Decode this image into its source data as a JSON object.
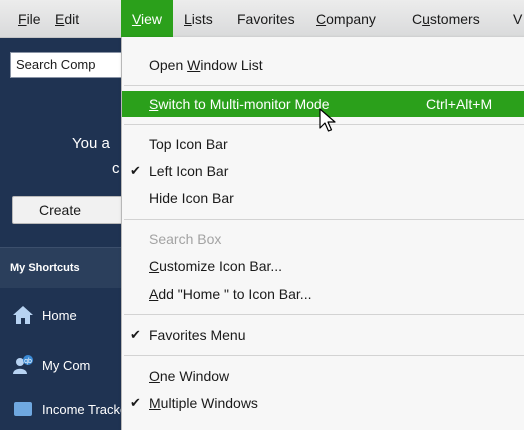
{
  "menubar": {
    "items": [
      {
        "label": "File",
        "mnemonic": "F",
        "rest": "ile"
      },
      {
        "label": "Edit",
        "mnemonic": "E",
        "rest": "dit"
      },
      {
        "label": "View",
        "mnemonic": "V",
        "rest": "iew"
      },
      {
        "label": "Lists",
        "mnemonic": "L",
        "rest": "ists"
      },
      {
        "label": "Favorites",
        "mnemonic": "",
        "rest": "Favorites"
      },
      {
        "label": "Company",
        "mnemonic": "C",
        "rest": "ompany"
      },
      {
        "label": "Customers",
        "pre": "C",
        "mnemonic": "u",
        "rest": "stomers"
      },
      {
        "label": "V"
      }
    ]
  },
  "sidebar": {
    "search_text": "Search Comp",
    "trial_line1": "You a",
    "trial_line2": "c",
    "create_label": "Create",
    "shortcuts_header": "My Shortcuts",
    "shortcuts": [
      {
        "label": "Home",
        "icon": "home-icon"
      },
      {
        "label": "My Com",
        "icon": "company-icon"
      },
      {
        "label": "Income Tracker",
        "icon": "income-tracker-icon"
      }
    ]
  },
  "view_menu": {
    "items": [
      {
        "pre": "Open ",
        "mnemonic": "W",
        "post": "indow List"
      },
      {
        "pre": "",
        "mnemonic": "S",
        "post": "witch to Multi-monitor Mode",
        "shortcut": "Ctrl+Alt+M",
        "highlighted": true
      },
      {
        "text": "Top Icon Bar"
      },
      {
        "text": "Left Icon Bar",
        "checked": true
      },
      {
        "text": "Hide Icon Bar"
      },
      {
        "text": "Search Box",
        "disabled": true
      },
      {
        "pre": "",
        "mnemonic": "C",
        "post": "ustomize Icon Bar..."
      },
      {
        "pre": "",
        "mnemonic": "A",
        "post": "dd \"Home \" to Icon Bar..."
      },
      {
        "text": "Favorites Menu",
        "checked": true
      },
      {
        "pre": "",
        "mnemonic": "O",
        "post": "ne Window"
      },
      {
        "pre": "",
        "mnemonic": "M",
        "post": "ultiple Windows",
        "checked": true
      }
    ]
  },
  "colors": {
    "accent_green": "#2ba01b",
    "sidebar_navy": "#1f3352"
  }
}
